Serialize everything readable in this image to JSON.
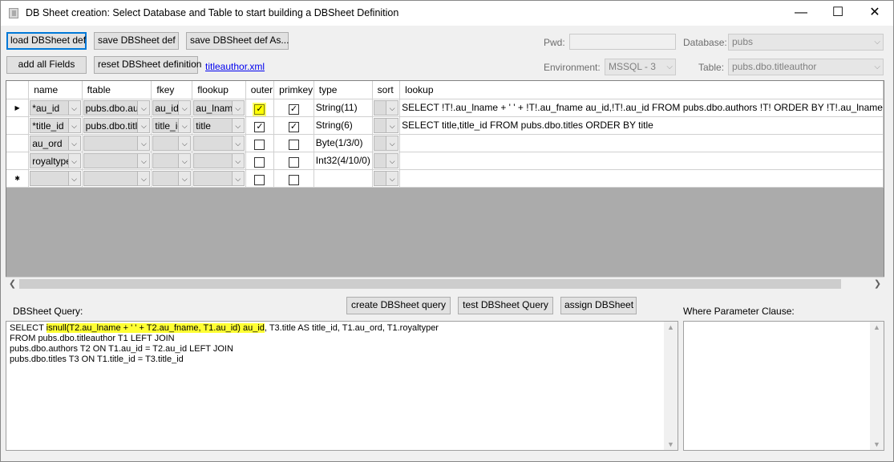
{
  "window": {
    "title": "DB Sheet creation: Select Database and Table to start building a DBSheet Definition",
    "minimize": "—",
    "maximize": "☐",
    "close": "✕"
  },
  "toolbar": {
    "load_label": "load DBSheet def",
    "save_label": "save DBSheet def",
    "save_as_label": "save DBSheet def As...",
    "add_all_label": "add all Fields",
    "reset_label": "reset DBSheet definition",
    "file_link": "titleauthor.xml"
  },
  "connection": {
    "pwd_label": "Pwd:",
    "pwd_value": "",
    "database_label": "Database:",
    "database_value": "pubs",
    "environment_label": "Environment:",
    "environment_value": "MSSQL - 3",
    "table_label": "Table:",
    "table_value": "pubs.dbo.titleauthor"
  },
  "grid": {
    "columns": [
      "name",
      "ftable",
      "fkey",
      "flookup",
      "outer",
      "primkey",
      "type",
      "sort",
      "lookup"
    ],
    "rows": [
      {
        "indicator": "▶",
        "name": "*au_id",
        "ftable": "pubs.dbo.authors",
        "fkey": "au_id",
        "flookup": "au_lname",
        "outer": "✓",
        "primkey": "✓",
        "type": "String(11)",
        "sort": "",
        "lookup": "SELECT !T!.au_lname + ' ' + !T!.au_fname au_id,!T!.au_id FROM pubs.dbo.authors !T! ORDER BY !T!.au_lname"
      },
      {
        "indicator": "",
        "name": "*title_id",
        "ftable": "pubs.dbo.titles",
        "fkey": "title_id",
        "flookup": "title",
        "outer": "✓",
        "primkey": "✓",
        "type": "String(6)",
        "sort": "",
        "lookup": "SELECT title,title_id FROM pubs.dbo.titles ORDER BY title"
      },
      {
        "indicator": "",
        "name": "au_ord",
        "ftable": "",
        "fkey": "",
        "flookup": "",
        "outer": "",
        "primkey": "",
        "type": "Byte(1/3/0)",
        "sort": "",
        "lookup": ""
      },
      {
        "indicator": "",
        "name": "royaltyper",
        "ftable": "",
        "fkey": "",
        "flookup": "",
        "outer": "",
        "primkey": "",
        "type": "Int32(4/10/0)",
        "sort": "",
        "lookup": ""
      },
      {
        "indicator": "✱",
        "name": "",
        "ftable": "",
        "fkey": "",
        "flookup": "",
        "outer": "",
        "primkey": "",
        "type": "",
        "sort": "",
        "lookup": ""
      }
    ]
  },
  "actions": {
    "create_label": "create DBSheet query",
    "test_label": "test DBSheet Query",
    "assign_label": "assign DBSheet"
  },
  "query": {
    "label": "DBSheet Query:",
    "line1_pre": "SELECT ",
    "line1_hl": "isnull(T2.au_lname + ' ' + T2.au_fname, T1.au_id) au_id",
    "line1_post": ", T3.title AS title_id, T1.au_ord, T1.royaltyper",
    "line2": "FROM pubs.dbo.titleauthor T1 LEFT JOIN",
    "line3": "pubs.dbo.authors T2 ON T1.au_id = T2.au_id LEFT JOIN",
    "line4": "pubs.dbo.titles T3 ON T1.title_id = T3.title_id"
  },
  "where": {
    "label": "Where Parameter Clause:",
    "value": ""
  },
  "colors": {
    "highlight": "#ffff33",
    "focus_border": "#0078d7",
    "link": "#0000ee"
  }
}
